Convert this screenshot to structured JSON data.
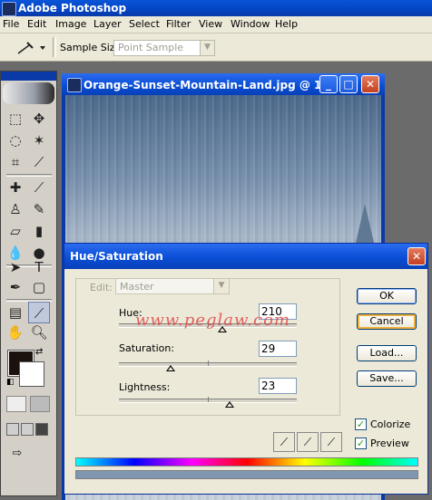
{
  "app": {
    "title": "Adobe Photoshop"
  },
  "menu": [
    "File",
    "Edit",
    "Image",
    "Layer",
    "Select",
    "Filter",
    "View",
    "Window",
    "Help"
  ],
  "options_bar": {
    "sample_size_label": "Sample Size:",
    "sample_size_value": "Point Sample"
  },
  "document": {
    "title": "Orange-Sunset-Mountain-Land.jpg @ 1..."
  },
  "dialog": {
    "title": "Hue/Saturation",
    "edit_label": "Edit:",
    "edit_value": "Master",
    "hue_label": "Hue:",
    "hue_value": "210",
    "saturation_label": "Saturation:",
    "saturation_value": "29",
    "lightness_label": "Lightness:",
    "lightness_value": "23",
    "hue_fraction": 0.58,
    "saturation_fraction": 0.29,
    "lightness_fraction": 0.62,
    "buttons": {
      "ok": "OK",
      "cancel": "Cancel",
      "load": "Load...",
      "save": "Save..."
    },
    "colorize_label": "Colorize",
    "colorize_checked": true,
    "preview_label": "Preview",
    "preview_checked": true,
    "watermark": "www.peglaw.com",
    "spectrum_result_color": "#7f97b0"
  },
  "toolbox": {
    "foreground_color": "#1c120d",
    "background_color": "#ffffff"
  }
}
